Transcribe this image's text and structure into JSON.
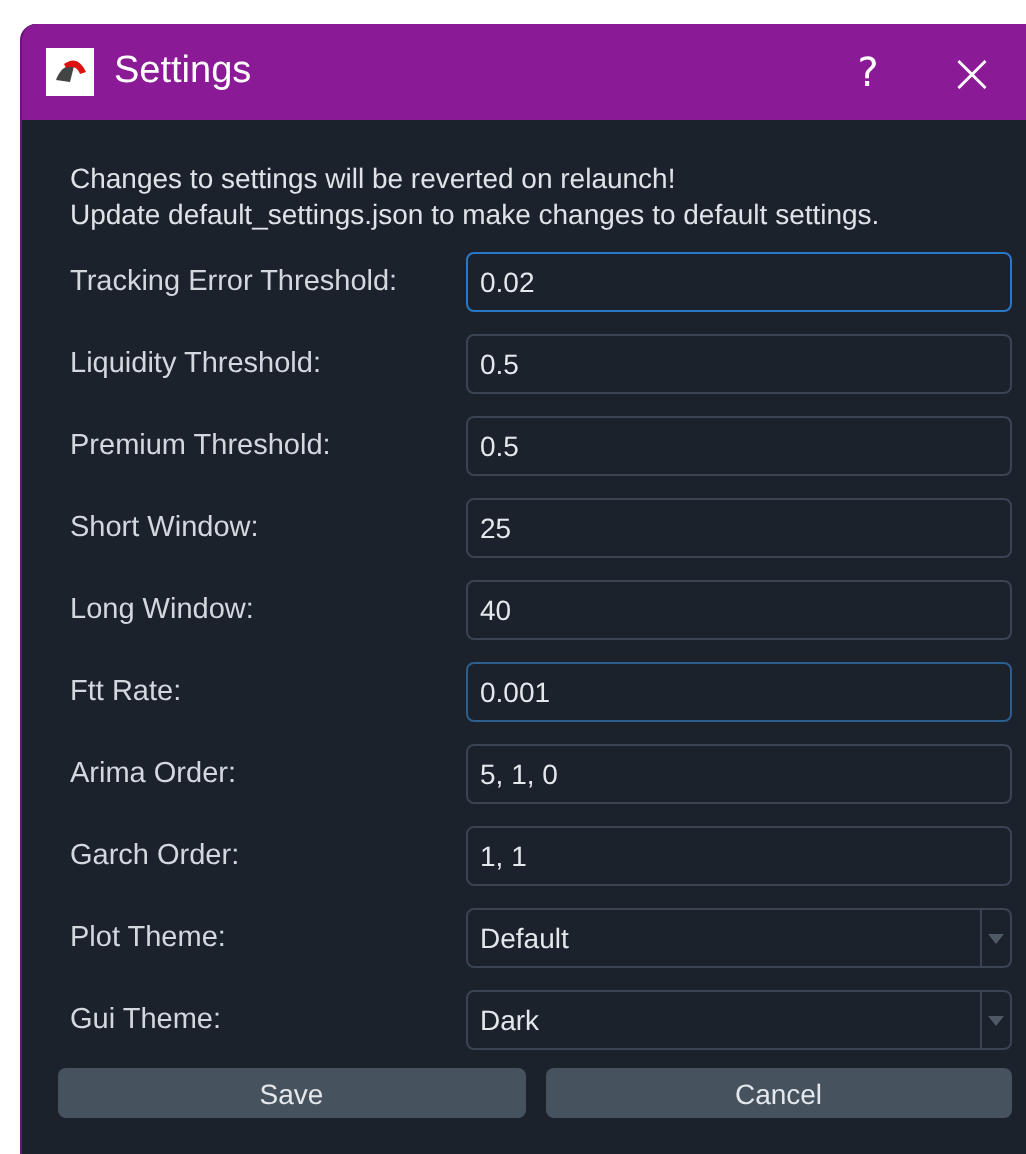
{
  "window": {
    "title": "Settings",
    "help": "?",
    "close": "×"
  },
  "message": [
    "Changes to settings will be reverted on relaunch!",
    "Update default_settings.json to make changes to default settings."
  ],
  "fields": [
    {
      "kind": "text",
      "label": "Tracking Error Threshold:",
      "value": "0.02",
      "focused": true,
      "hovered": false
    },
    {
      "kind": "text",
      "label": "Liquidity Threshold:",
      "value": "0.5",
      "focused": false,
      "hovered": false
    },
    {
      "kind": "text",
      "label": "Premium Threshold:",
      "value": "0.5",
      "focused": false,
      "hovered": false
    },
    {
      "kind": "text",
      "label": "Short Window:",
      "value": "25",
      "focused": false,
      "hovered": false
    },
    {
      "kind": "text",
      "label": "Long Window:",
      "value": "40",
      "focused": false,
      "hovered": false
    },
    {
      "kind": "text",
      "label": "Ftt Rate:",
      "value": "0.001",
      "focused": false,
      "hovered": true
    },
    {
      "kind": "text",
      "label": "Arima Order:",
      "value": "5, 1, 0",
      "focused": false,
      "hovered": false
    },
    {
      "kind": "text",
      "label": "Garch Order:",
      "value": "1, 1",
      "focused": false,
      "hovered": false
    },
    {
      "kind": "dropdown",
      "label": "Plot Theme:",
      "value": "Default",
      "focused": false,
      "hovered": false
    },
    {
      "kind": "dropdown",
      "label": "Gui Theme:",
      "value": "Dark",
      "focused": false,
      "hovered": false
    }
  ],
  "buttons": [
    "Save",
    "Cancel"
  ]
}
